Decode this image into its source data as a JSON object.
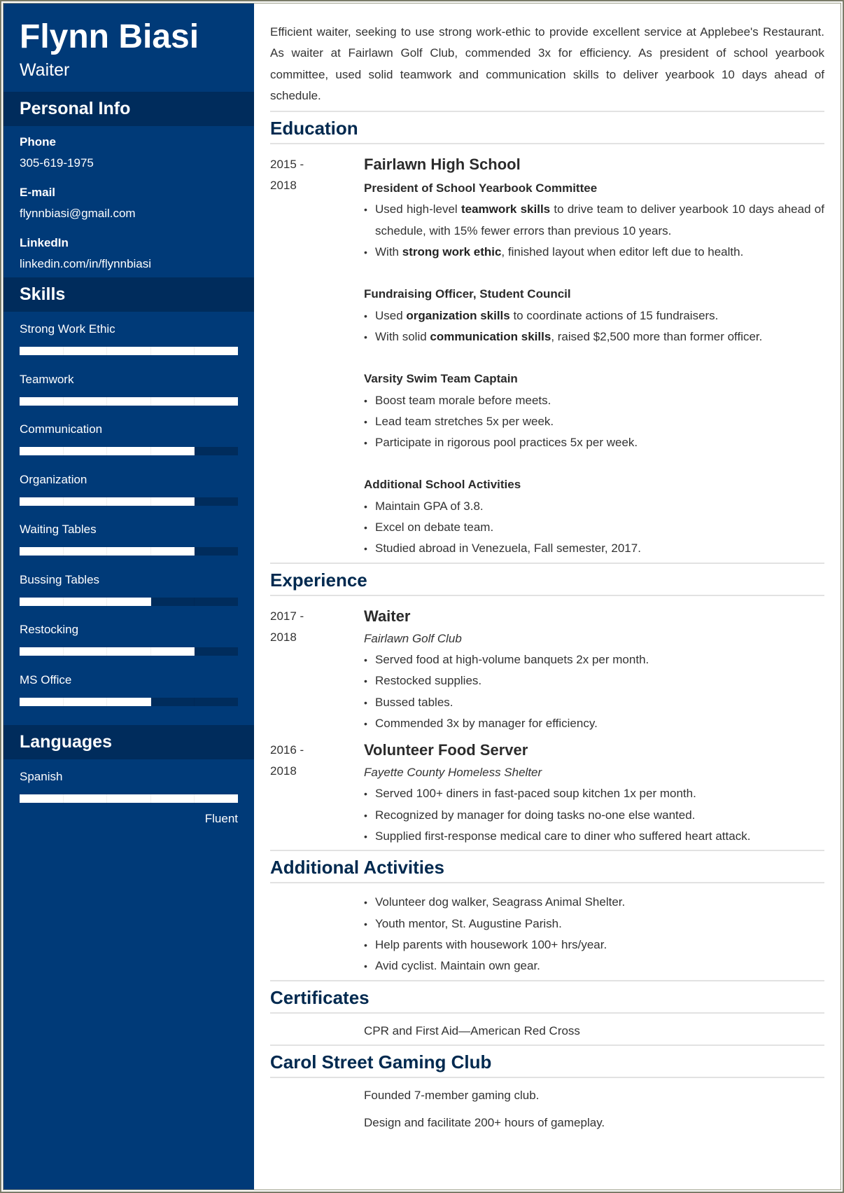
{
  "profile": {
    "name": "Flynn Biasi",
    "title": "Waiter"
  },
  "colors": {
    "sidebar_bg": "#003a78",
    "sidebar_heading_bg": "#002c5c",
    "section_title": "#00294f",
    "frame_border": "#7a7b68"
  },
  "sidebar": {
    "personal_info_heading": "Personal Info",
    "personal_info": [
      {
        "label": "Phone",
        "value": "305-619-1975"
      },
      {
        "label": "E-mail",
        "value": "flynnbiasi@gmail.com"
      },
      {
        "label": "LinkedIn",
        "value": "linkedin.com/in/flynnbiasi"
      }
    ],
    "skills_heading": "Skills",
    "skills": [
      {
        "name": "Strong Work Ethic",
        "level": 5,
        "max": 5
      },
      {
        "name": "Teamwork",
        "level": 5,
        "max": 5
      },
      {
        "name": "Communication",
        "level": 4,
        "max": 5
      },
      {
        "name": "Organization",
        "level": 4,
        "max": 5
      },
      {
        "name": "Waiting Tables",
        "level": 4,
        "max": 5
      },
      {
        "name": "Bussing Tables",
        "level": 3,
        "max": 5
      },
      {
        "name": "Restocking",
        "level": 4,
        "max": 5
      },
      {
        "name": "MS Office",
        "level": 3,
        "max": 5
      }
    ],
    "languages_heading": "Languages",
    "languages": [
      {
        "name": "Spanish",
        "level": 5,
        "max": 5,
        "level_label": "Fluent"
      }
    ]
  },
  "main": {
    "summary": "Efficient waiter, seeking to use strong work-ethic to provide excellent service at Applebee's Restaurant. As waiter at Fairlawn Golf Club, commended 3x for efficiency. As president of school yearbook committee, used solid teamwork and communication skills to deliver yearbook 10 days ahead of schedule.",
    "education": {
      "heading": "Education",
      "entries": [
        {
          "date_start": "2015 -",
          "date_end": "2018",
          "school": "Fairlawn High School",
          "groups": [
            {
              "title": "President of School Yearbook Committee",
              "bullets": [
                {
                  "pre": "Used high-level ",
                  "bold": "teamwork skills",
                  "post": " to drive team to deliver yearbook 10 days ahead of schedule, with 15% fewer errors than previous 10 years."
                },
                {
                  "pre": "With ",
                  "bold": "strong work ethic",
                  "post": ", finished layout when editor left due to health."
                }
              ]
            },
            {
              "title": "Fundraising Officer, Student Council",
              "bullets": [
                {
                  "pre": "Used ",
                  "bold": "organization skills",
                  "post": " to coordinate actions of 15 fundraisers."
                },
                {
                  "pre": "With solid ",
                  "bold": "communication skills",
                  "post": ", raised $2,500 more than former officer."
                }
              ]
            },
            {
              "title": "Varsity Swim Team Captain",
              "bullets": [
                {
                  "pre": "Boost team morale before meets.",
                  "bold": "",
                  "post": ""
                },
                {
                  "pre": "Lead team stretches 5x per week.",
                  "bold": "",
                  "post": ""
                },
                {
                  "pre": "Participate in rigorous pool practices 5x per week.",
                  "bold": "",
                  "post": ""
                }
              ]
            },
            {
              "title": "Additional School Activities",
              "bullets": [
                {
                  "pre": "Maintain GPA of 3.8.",
                  "bold": "",
                  "post": ""
                },
                {
                  "pre": "Excel on debate team.",
                  "bold": "",
                  "post": ""
                },
                {
                  "pre": "Studied abroad in Venezuela, Fall semester, 2017.",
                  "bold": "",
                  "post": ""
                }
              ]
            }
          ]
        }
      ]
    },
    "experience": {
      "heading": "Experience",
      "entries": [
        {
          "date_start": "2017 -",
          "date_end": "2018",
          "role": "Waiter",
          "employer": "Fairlawn Golf Club",
          "bullets": [
            "Served food at high-volume banquets 2x per month.",
            "Restocked supplies.",
            "Bussed tables.",
            "Commended 3x by manager for efficiency."
          ]
        },
        {
          "date_start": "2016 -",
          "date_end": "2018",
          "role": "Volunteer Food Server",
          "employer": "Fayette County Homeless Shelter",
          "bullets": [
            "Served 100+ diners in fast-paced soup kitchen 1x per month.",
            "Recognized by manager for doing tasks no-one else wanted.",
            "Supplied first-response medical care to diner who suffered heart attack."
          ]
        }
      ]
    },
    "additional_activities": {
      "heading": "Additional Activities",
      "bullets": [
        "Volunteer dog walker, Seagrass Animal Shelter.",
        "Youth mentor, St. Augustine Parish.",
        "Help parents with housework 100+ hrs/year.",
        "Avid cyclist. Maintain own gear."
      ]
    },
    "certificates": {
      "heading": "Certificates",
      "items": [
        "CPR and First Aid—American Red Cross"
      ]
    },
    "gaming_club": {
      "heading": "Carol Street Gaming Club",
      "items": [
        "Founded 7-member gaming club.",
        "Design and facilitate 200+ hours of gameplay."
      ]
    }
  }
}
